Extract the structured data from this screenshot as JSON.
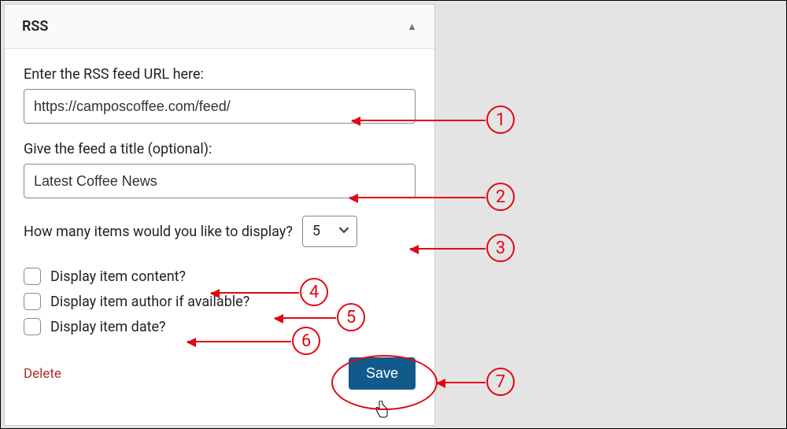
{
  "panel": {
    "title": "RSS"
  },
  "fields": {
    "url_label": "Enter the RSS feed URL here:",
    "url_value": "https://camposcoffee.com/feed/",
    "title_label": "Give the feed a title (optional):",
    "title_value": "Latest Coffee News",
    "count_label": "How many items would you like to display?",
    "count_value": "5",
    "cb_content": "Display item content?",
    "cb_author": "Display item author if available?",
    "cb_date": "Display item date?"
  },
  "actions": {
    "delete": "Delete",
    "save": "Save"
  },
  "annotations": {
    "n1": "1",
    "n2": "2",
    "n3": "3",
    "n4": "4",
    "n5": "5",
    "n6": "6",
    "n7": "7"
  }
}
